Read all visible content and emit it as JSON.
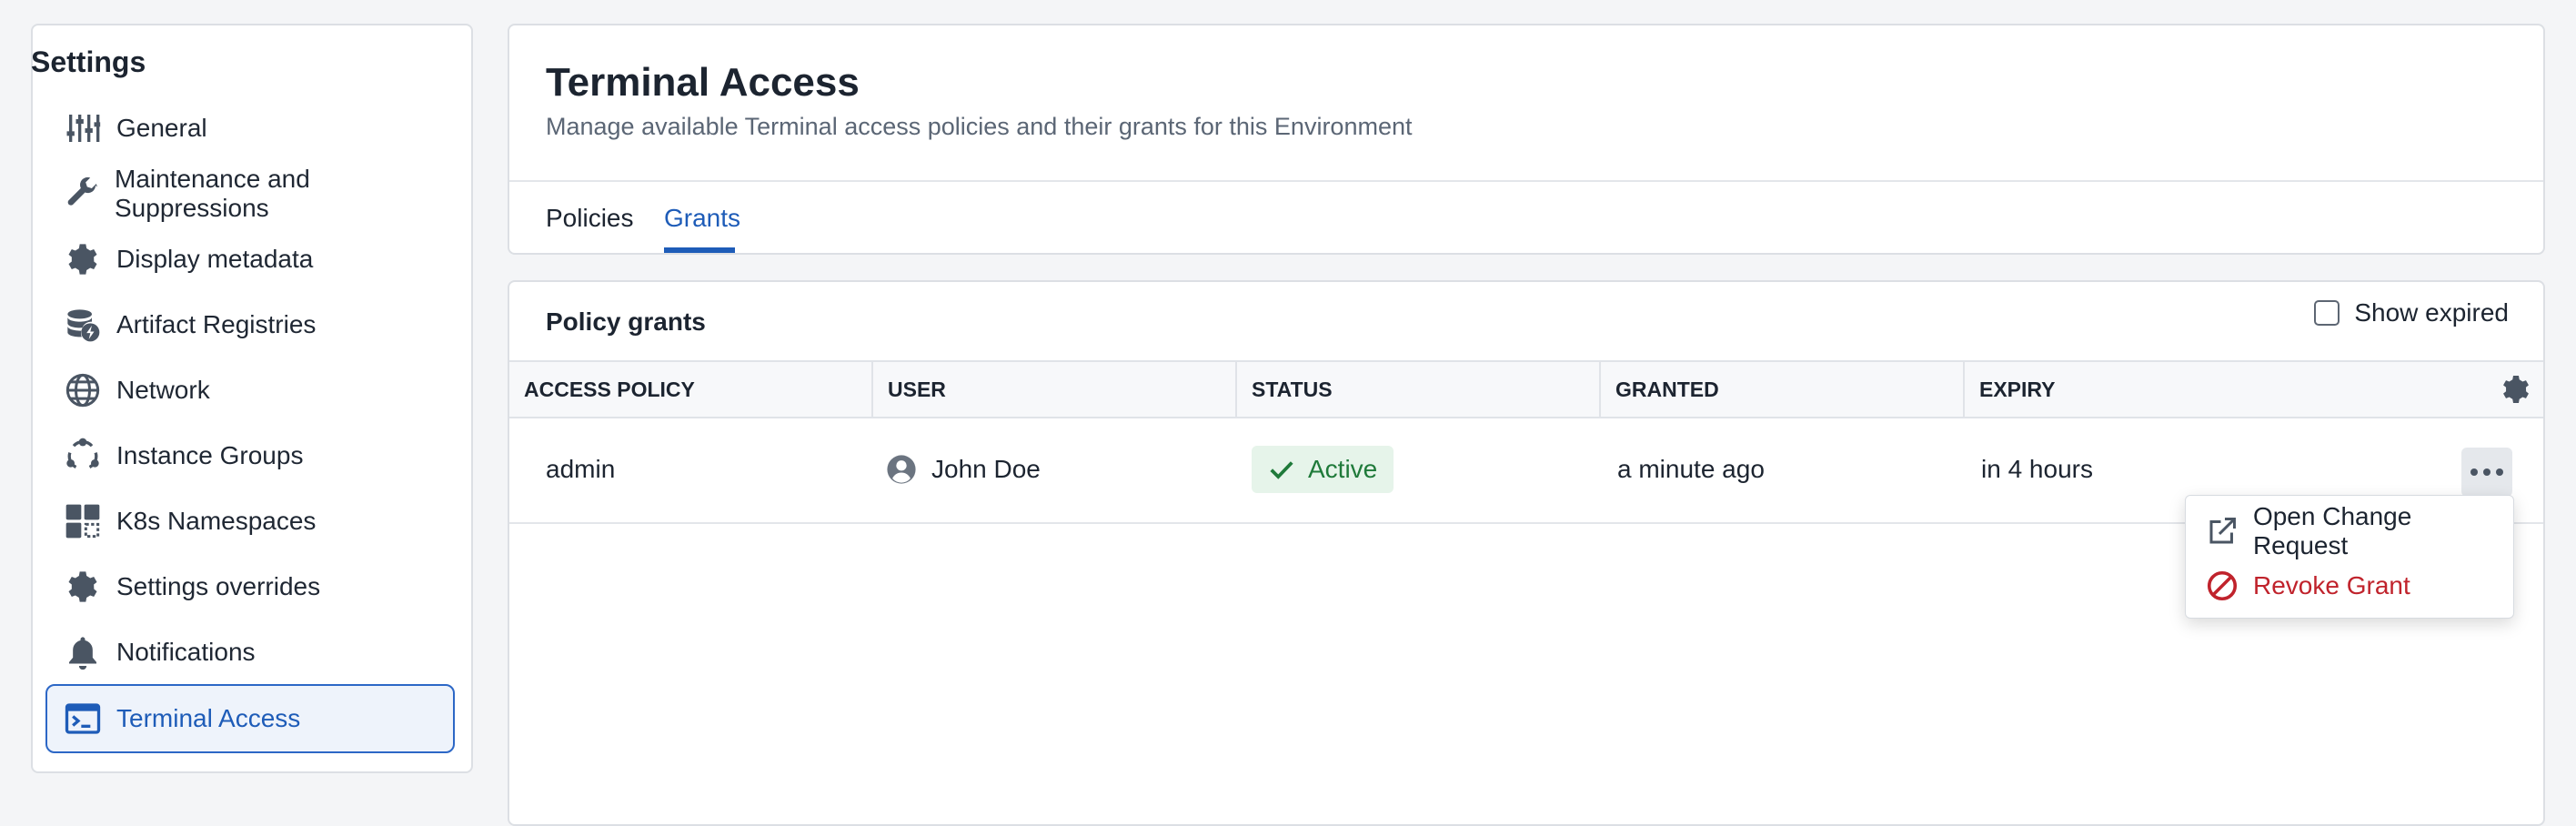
{
  "sidebar": {
    "title": "Settings",
    "items": [
      {
        "label": "General",
        "icon": "sliders-icon"
      },
      {
        "label": "Maintenance and Suppressions",
        "icon": "wrench-icon"
      },
      {
        "label": "Display metadata",
        "icon": "gear-icon"
      },
      {
        "label": "Artifact Registries",
        "icon": "database-bolt-icon"
      },
      {
        "label": "Network",
        "icon": "globe-icon"
      },
      {
        "label": "Instance Groups",
        "icon": "cycle-icon"
      },
      {
        "label": "K8s Namespaces",
        "icon": "grid-icon"
      },
      {
        "label": "Settings overrides",
        "icon": "gear-icon"
      },
      {
        "label": "Notifications",
        "icon": "bell-icon"
      },
      {
        "label": "Terminal Access",
        "icon": "terminal-icon",
        "active": true
      }
    ]
  },
  "header": {
    "title": "Terminal Access",
    "subtitle": "Manage available Terminal access policies and their grants for this Environment",
    "tabs": [
      {
        "label": "Policies"
      },
      {
        "label": "Grants",
        "active": true
      }
    ]
  },
  "grants": {
    "title": "Policy grants",
    "show_expired_label": "Show expired",
    "show_expired_checked": false,
    "columns": [
      "ACCESS POLICY",
      "USER",
      "STATUS",
      "GRANTED",
      "EXPIRY"
    ],
    "rows": [
      {
        "policy": "admin",
        "user": "John Doe",
        "status": "Active",
        "granted": "a minute ago",
        "expiry": "in 4 hours"
      }
    ]
  },
  "menu": {
    "items": [
      {
        "label": "Open Change Request",
        "icon": "external-link-icon"
      },
      {
        "label": "Revoke Grant",
        "icon": "ban-icon",
        "danger": true
      }
    ]
  },
  "colors": {
    "accent": "#1e5cb8",
    "active_bg": "#eef3fb",
    "status_bg": "#e6f4ea",
    "status_fg": "#1f7a3a",
    "danger": "#c0232c"
  }
}
